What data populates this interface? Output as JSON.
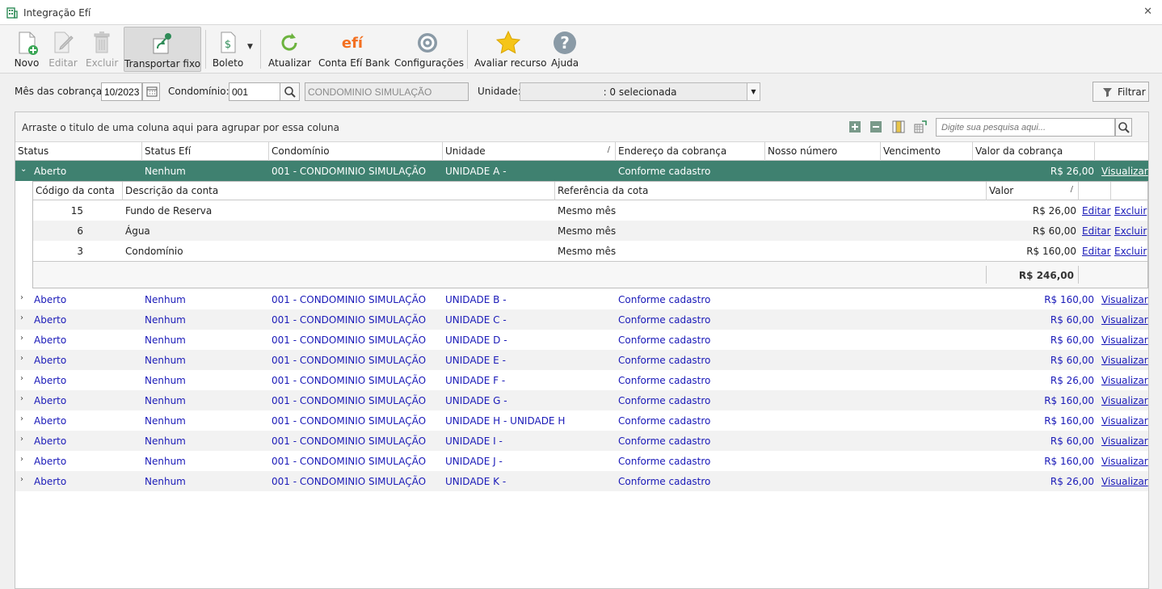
{
  "window": {
    "title": "Integração Efí",
    "close_glyph": "✕"
  },
  "toolbar": {
    "buttons": [
      {
        "label": "Novo",
        "icon": "new-document-icon",
        "enabled": true
      },
      {
        "label": "Editar",
        "icon": "pencil-icon",
        "enabled": false
      },
      {
        "label": "Excluir",
        "icon": "trash-icon",
        "enabled": false
      },
      {
        "label": "Transportar fixo",
        "icon": "transport-icon",
        "enabled": true,
        "active": true
      },
      {
        "label": "Boleto",
        "icon": "boleto-icon",
        "enabled": true
      },
      {
        "label": "Atualizar",
        "icon": "refresh-icon",
        "enabled": true
      },
      {
        "label": "Conta Efí Bank",
        "icon": "efi-logo-icon",
        "enabled": true,
        "logo_text": "efí"
      },
      {
        "label": "Configurações",
        "icon": "gear-icon",
        "enabled": true
      },
      {
        "label": "Avaliar recurso",
        "icon": "star-icon",
        "enabled": true
      },
      {
        "label": "Ajuda",
        "icon": "help-icon",
        "enabled": true
      }
    ]
  },
  "filters": {
    "mes_label": "Mês das cobranças:",
    "mes_value": "10/2023",
    "condominio_label": "Condomínio:",
    "condominio_code": "001",
    "condominio_name": "CONDOMINIO SIMULAÇÃO",
    "unidade_label": "Unidade:",
    "unidade_value": ": 0 selecionada",
    "filtrar_label": "Filtrar"
  },
  "grid": {
    "group_hint": "Arraste o titulo de uma coluna aqui para agrupar por essa coluna",
    "search_placeholder": "Digite sua pesquisa aqui...",
    "columns": [
      "Status",
      "Status Efí",
      "Condomínio",
      "Unidade",
      "Endereço da cobrança",
      "Nosso número",
      "Vencimento",
      "Valor da cobrança"
    ],
    "sort_mark": "/",
    "rows": [
      {
        "status": "Aberto",
        "status_efi": "Nenhum",
        "condominio": "001 - CONDOMINIO SIMULAÇÃO",
        "unidade": "UNIDADE A -",
        "endereco": "Conforme cadastro",
        "valor": "R$ 26,00",
        "action": "Visualizar",
        "expanded": true
      },
      {
        "status": "Aberto",
        "status_efi": "Nenhum",
        "condominio": "001 - CONDOMINIO SIMULAÇÃO",
        "unidade": "UNIDADE B -",
        "endereco": "Conforme cadastro",
        "valor": "R$ 160,00",
        "action": "Visualizar"
      },
      {
        "status": "Aberto",
        "status_efi": "Nenhum",
        "condominio": "001 - CONDOMINIO SIMULAÇÃO",
        "unidade": "UNIDADE C -",
        "endereco": "Conforme cadastro",
        "valor": "R$ 60,00",
        "action": "Visualizar"
      },
      {
        "status": "Aberto",
        "status_efi": "Nenhum",
        "condominio": "001 - CONDOMINIO SIMULAÇÃO",
        "unidade": "UNIDADE D -",
        "endereco": "Conforme cadastro",
        "valor": "R$ 60,00",
        "action": "Visualizar"
      },
      {
        "status": "Aberto",
        "status_efi": "Nenhum",
        "condominio": "001 - CONDOMINIO SIMULAÇÃO",
        "unidade": "UNIDADE E -",
        "endereco": "Conforme cadastro",
        "valor": "R$ 60,00",
        "action": "Visualizar"
      },
      {
        "status": "Aberto",
        "status_efi": "Nenhum",
        "condominio": "001 - CONDOMINIO SIMULAÇÃO",
        "unidade": "UNIDADE F -",
        "endereco": "Conforme cadastro",
        "valor": "R$ 26,00",
        "action": "Visualizar"
      },
      {
        "status": "Aberto",
        "status_efi": "Nenhum",
        "condominio": "001 - CONDOMINIO SIMULAÇÃO",
        "unidade": "UNIDADE G -",
        "endereco": "Conforme cadastro",
        "valor": "R$ 160,00",
        "action": "Visualizar"
      },
      {
        "status": "Aberto",
        "status_efi": "Nenhum",
        "condominio": "001 - CONDOMINIO SIMULAÇÃO",
        "unidade": "UNIDADE H - UNIDADE H",
        "endereco": "Conforme cadastro",
        "valor": "R$ 160,00",
        "action": "Visualizar"
      },
      {
        "status": "Aberto",
        "status_efi": "Nenhum",
        "condominio": "001 - CONDOMINIO SIMULAÇÃO",
        "unidade": "UNIDADE I -",
        "endereco": "Conforme cadastro",
        "valor": "R$ 60,00",
        "action": "Visualizar"
      },
      {
        "status": "Aberto",
        "status_efi": "Nenhum",
        "condominio": "001 - CONDOMINIO SIMULAÇÃO",
        "unidade": "UNIDADE J -",
        "endereco": "Conforme cadastro",
        "valor": "R$ 160,00",
        "action": "Visualizar"
      },
      {
        "status": "Aberto",
        "status_efi": "Nenhum",
        "condominio": "001 - CONDOMINIO SIMULAÇÃO",
        "unidade": "UNIDADE K -",
        "endereco": "Conforme cadastro",
        "valor": "R$ 26,00",
        "action": "Visualizar"
      }
    ],
    "detail": {
      "columns": [
        "Código da conta",
        "Descrição da conta",
        "Referência da cota",
        "Valor"
      ],
      "rows": [
        {
          "codigo": "15",
          "descricao": "Fundo  de Reserva",
          "referencia": "Mesmo mês",
          "valor": "R$ 26,00",
          "edit": "Editar",
          "delete": "Excluir"
        },
        {
          "codigo": "6",
          "descricao": "Água",
          "referencia": "Mesmo mês",
          "valor": "R$ 60,00",
          "edit": "Editar",
          "delete": "Excluir"
        },
        {
          "codigo": "3",
          "descricao": "Condomínio",
          "referencia": "Mesmo mês",
          "valor": "R$ 160,00",
          "edit": "Editar",
          "delete": "Excluir"
        }
      ],
      "total": "R$ 246,00"
    }
  },
  "colors": {
    "selected_row": "#3f8170",
    "link_blue": "#1a1ab8",
    "efi_orange": "#f37021"
  }
}
